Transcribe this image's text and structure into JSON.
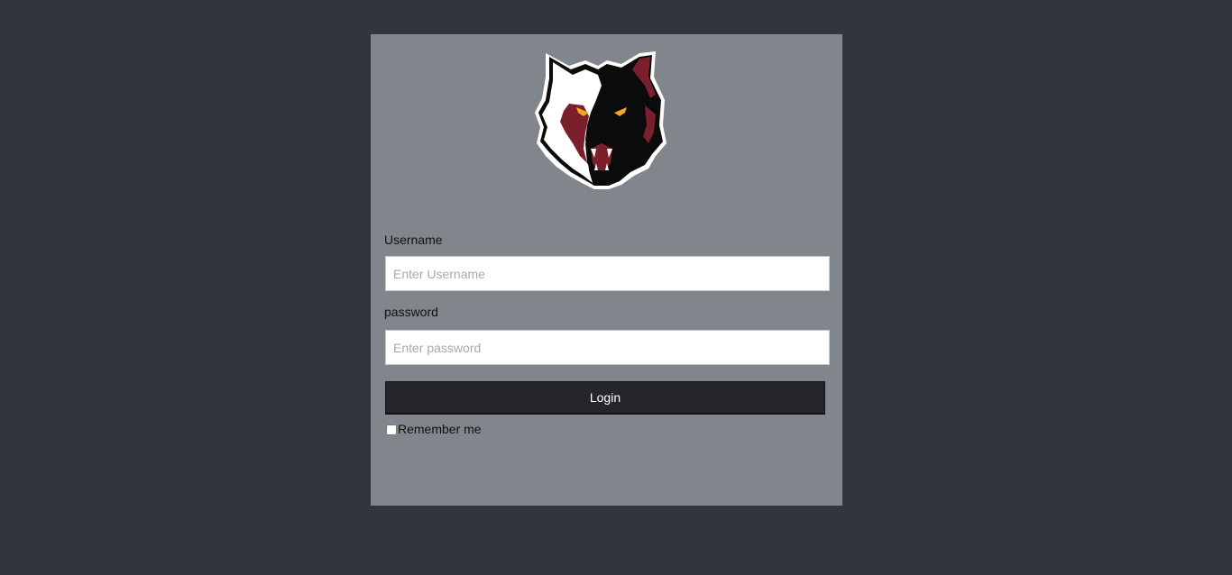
{
  "logo": {
    "name": "wolf-logo",
    "colors": {
      "maroon": "#7a1f2b",
      "black": "#0b0b0b",
      "white": "#ffffff",
      "eyes": "#f5a623"
    }
  },
  "form": {
    "username_label": "Username",
    "username_placeholder": "Enter Username",
    "password_label": "password",
    "password_placeholder": "Enter password",
    "login_label": "Login",
    "remember_label": "Remember me"
  },
  "colors": {
    "background": "#33353d",
    "card": "#81858c",
    "button": "#24262b"
  }
}
